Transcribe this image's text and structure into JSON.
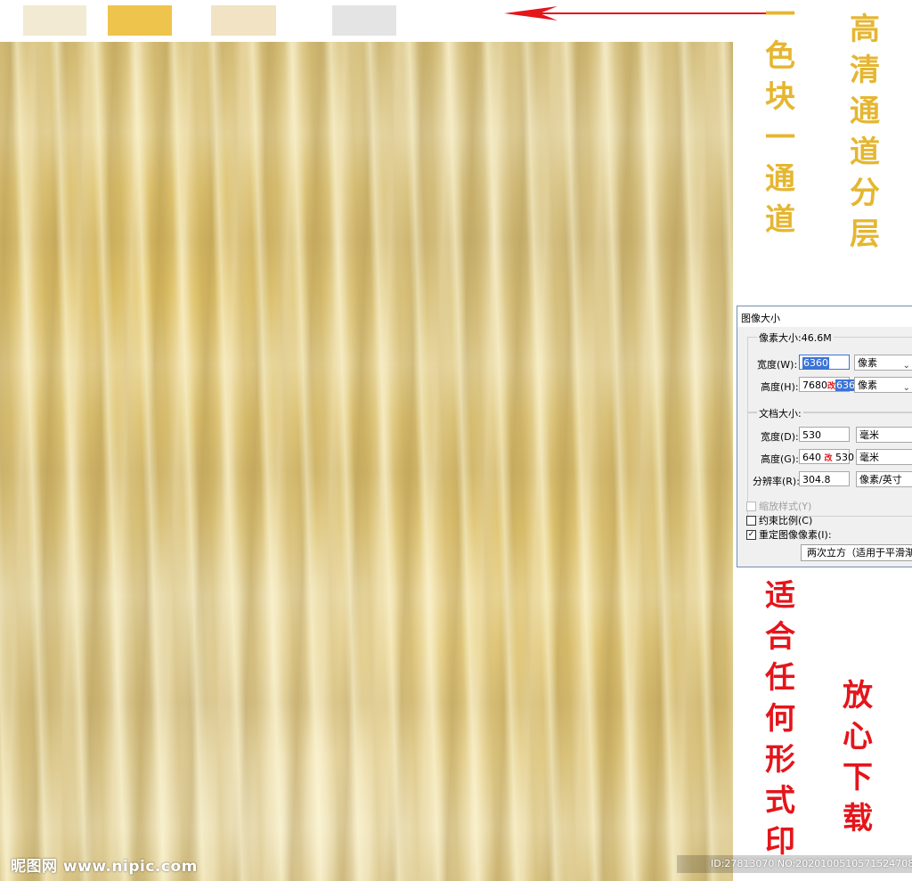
{
  "swatches": [
    {
      "name": "swatch-cream",
      "color": "#f2ead2"
    },
    {
      "name": "swatch-gold",
      "color": "#efc44c"
    },
    {
      "name": "swatch-beige",
      "color": "#f1e3c4"
    },
    {
      "name": "swatch-gray",
      "color": "#e4e4e4"
    }
  ],
  "annotations": {
    "col1": [
      "一",
      "色",
      "块",
      "一",
      "通",
      "道"
    ],
    "col2": [
      "高",
      "清",
      "通",
      "道",
      "分",
      "层"
    ],
    "col3": [
      "适",
      "合",
      "任",
      "何",
      "形",
      "式",
      "印"
    ],
    "col4": [
      "放",
      "心",
      "下",
      "载"
    ],
    "gold_color": "#e5b631",
    "red_color": "#e4151b"
  },
  "watermark": "昵图网 www.nipic.com",
  "image_id": "ID:27813070 NO:20201005105715247085",
  "dialog": {
    "title": "图像大小",
    "pixel_group": {
      "title": "像素大小:46.6M",
      "width_label": "宽度(W):",
      "width_value": "6360",
      "width_unit": "像素",
      "height_label": "高度(H):",
      "height_value_old": "7680",
      "height_annotation": "改",
      "height_value_new": "6360",
      "height_unit": "像素"
    },
    "doc_group": {
      "title": "文档大小:",
      "width_label": "宽度(D):",
      "width_value": "530",
      "width_unit": "毫米",
      "height_label": "高度(G):",
      "height_value_old": "640",
      "height_annotation": "改",
      "height_value_new": "530",
      "height_unit": "毫米",
      "resolution_label": "分辨率(R):",
      "resolution_value": "304.8",
      "resolution_unit": "像素/英寸"
    },
    "checkboxes": {
      "scale_styles": "缩放样式(Y)",
      "constrain": "约束比例(C)",
      "resample": "重定图像像素(I):",
      "resample_checked": "✓"
    },
    "resample_method": "两次立方（适用于平滑渐变"
  }
}
